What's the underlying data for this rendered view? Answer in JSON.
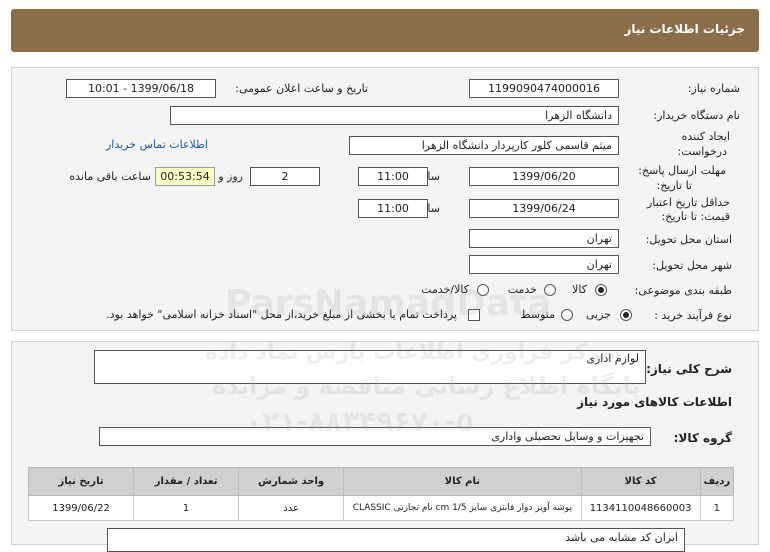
{
  "header": {
    "title": "جزئیات اطلاعات نیاز"
  },
  "form": {
    "need_number_label": "شماره نیاز:",
    "need_number": "1199090474000016",
    "announce_label": "تاریخ و ساعت اعلان عمومی:",
    "announce_value": "1399/06/18 - 10:01",
    "buyer_org_label": "نام دستگاه خریدار:",
    "buyer_org": "دانشگاه الزهرا",
    "creator_label_1": "ایجاد کننده",
    "creator_label_2": "درخواست:",
    "creator": "میثم  قاسمی کلور کارپرداز دانشگاه الزهرا",
    "contact_link": "اطلاعات تماس خریدار",
    "reply_deadline_label_1": "مهلت ارسال پاسخ:",
    "reply_deadline_label_2": "تا تاریخ:",
    "reply_date": "1399/06/20",
    "time_label": "ساعت",
    "reply_time": "11:00",
    "days_value": "2",
    "days_label": "روز و",
    "remaining_time": "00:53:54",
    "remaining_label": "ساعت باقی مانده",
    "price_validity_label_1": "حداقل تاریخ اعتبار",
    "price_validity_label_2": "قیمت: تا تاریخ:",
    "price_date": "1399/06/24",
    "price_time_label": "ساعت",
    "price_time": "11:00",
    "province_label": "استان محل تحویل:",
    "province": "تهران",
    "city_label": "شهر محل تحویل:",
    "city": "تهران",
    "category_label": "طبقه بندی موضوعی:",
    "category_options": [
      "کالا",
      "خدمت",
      "کالا/خدمت"
    ],
    "category_selected": "کالا",
    "process_label": "نوع فرآیند خرید :",
    "process_options": [
      "جزیی",
      "متوسط"
    ],
    "process_selected": "جزیی",
    "payment_note": "پرداخت تمام یا بخشی از مبلغ خرید،از محل \"اسناد خزانه اسلامی\" خواهد بود."
  },
  "description": {
    "label": "شرح کلی نیاز:",
    "value": "لوازم اداری",
    "goods_info_title": "اطلاعات کالاهای مورد نیاز",
    "group_label": "گروه کالا:",
    "group_value": "تجهیزات و وسایل تحصیلی واداری"
  },
  "table": {
    "headers": [
      "ردیف",
      "کد کالا",
      "نام کالا",
      "واحد شمارش",
      "تعداد / مقدار",
      "تاریخ نیاز"
    ],
    "rows": [
      [
        "1",
        "1134110048660003",
        "پوشه آویز دوار فانتزی سایز cm 1/5 نام تجارتی CLASSIC",
        "عدد",
        "1",
        "1399/06/22"
      ]
    ]
  },
  "note": "ایران کد مشابه می باشد",
  "watermark": {
    "brand": "ParsNamadData",
    "line1": "مرکز فراوری اطلاعات پارس نماد داده",
    "line2": "پایگاه اطلاع رسانی مناقصه و مزایده",
    "phone": "۰۲۱-۸۸۳۴۹۶۷۰-۵"
  }
}
